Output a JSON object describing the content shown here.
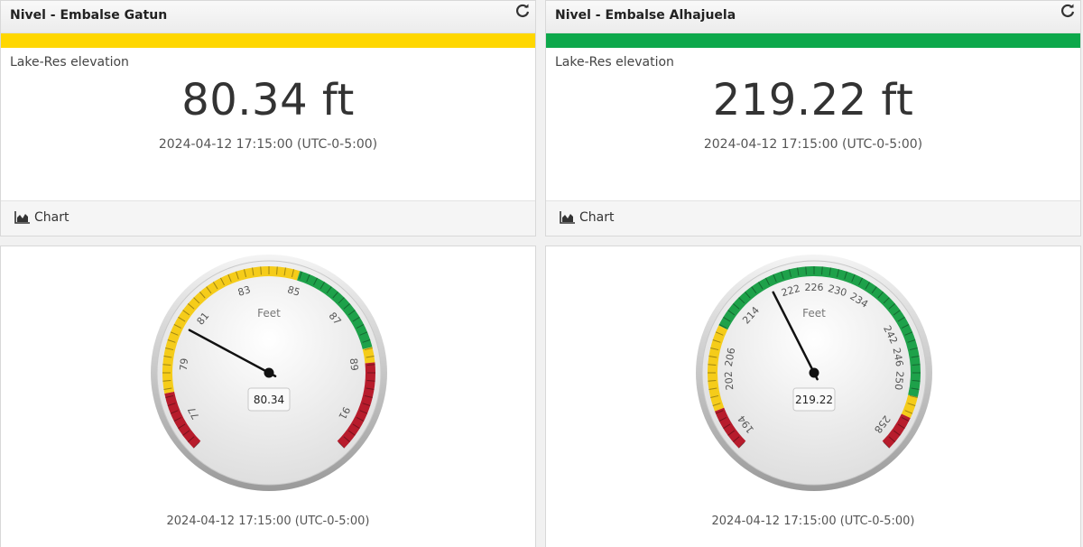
{
  "cards": [
    {
      "title": "Nivel - Embalse Gatun",
      "status_color": "#FFD700",
      "label": "Lake-Res elevation",
      "value": "80.34 ft",
      "timestamp": "2024-04-12 17:15:00 (UTC-0-5:00)",
      "chart_link": "Chart",
      "refresh_icon": "refresh-icon",
      "chart_icon": "area-chart-icon"
    },
    {
      "title": "Nivel - Embalse Alhajuela",
      "status_color": "#0DA84B",
      "label": "Lake-Res elevation",
      "value": "219.22 ft",
      "timestamp": "2024-04-12 17:15:00 (UTC-0-5:00)",
      "chart_link": "Chart",
      "refresh_icon": "refresh-icon",
      "chart_icon": "area-chart-icon"
    }
  ],
  "gauges": [
    {
      "unit_label": "Feet",
      "value": 80.34,
      "readout": "80.34",
      "min": 76,
      "max": 92,
      "tick_labels": [
        "77",
        "79",
        "81",
        "83",
        "85",
        "87",
        "89",
        "91"
      ],
      "bands": [
        {
          "from": 76,
          "to": 78,
          "color": "#B71C2C"
        },
        {
          "from": 78,
          "to": 85,
          "color": "#F5CC1A"
        },
        {
          "from": 85,
          "to": 88.5,
          "color": "#1EA14A"
        },
        {
          "from": 88.5,
          "to": 89,
          "color": "#F5CC1A"
        },
        {
          "from": 89,
          "to": 92,
          "color": "#B71C2C"
        }
      ],
      "timestamp": "2024-04-12 17:15:00 (UTC-0-5:00)"
    },
    {
      "unit_label": "Feet",
      "value": 219.22,
      "readout": "219.22",
      "min": 192,
      "max": 260,
      "tick_labels": [
        "194",
        "202",
        "206",
        "214",
        "222",
        "226",
        "230",
        "234",
        "242",
        "246",
        "250",
        "258"
      ],
      "bands": [
        {
          "from": 192,
          "to": 198,
          "color": "#B71C2C"
        },
        {
          "from": 198,
          "to": 210,
          "color": "#F5CC1A"
        },
        {
          "from": 210,
          "to": 252,
          "color": "#1EA14A"
        },
        {
          "from": 252,
          "to": 255,
          "color": "#F5CC1A"
        },
        {
          "from": 255,
          "to": 260,
          "color": "#B71C2C"
        }
      ],
      "timestamp": "2024-04-12 17:15:00 (UTC-0-5:00)"
    }
  ]
}
